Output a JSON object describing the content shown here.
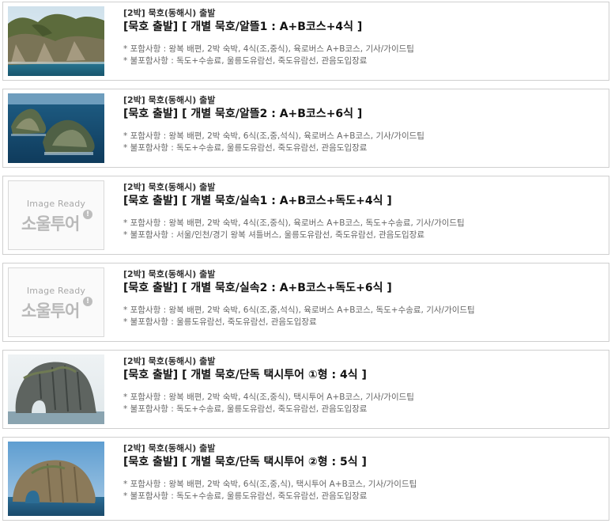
{
  "tours": [
    {
      "category": "[2박] 묵호(동해시) 출발",
      "title": "[묵호 출발] [ 개별 묵호/알뜰1 : A+B코스+4식 ]",
      "include": "* 포함사항 : 왕복 배편, 2박 숙박, 4식(조,중식), 육로버스 A+B코스, 기사/가이드팁",
      "exclude": "* 불포함사항 : 독도+수송료, 울릉도유람선, 죽도유람선, 관음도입장료",
      "image": "coastal-cliff-photo"
    },
    {
      "category": "[2박] 묵호(동해시) 출발",
      "title": "[묵호 출발] [ 개별 묵호/알뜰2 : A+B코스+6식 ]",
      "include": "* 포함사항 : 왕복 배편, 2박 숙박, 6식(조,중,석식), 육로버스 A+B코스, 기사/가이드팁",
      "exclude": "* 불포함사항 : 독도+수송료, 울릉도유람선, 죽도유람선, 관음도입장료",
      "image": "dokdo-islands-photo"
    },
    {
      "category": "[2박] 묵호(동해시) 출발",
      "title": "[묵호 출발] [ 개별 묵호/실속1 : A+B코스+독도+4식 ]",
      "include": "* 포함사항 : 왕복 배편, 2박 숙박, 4식(조,중식), 육로버스 A+B코스, 독도+수송료, 기사/가이드팁",
      "exclude": "* 불포함사항 : 서울/인천/경기 왕복 셔틀버스, 울릉도유람선, 죽도유람선, 관음도입장료",
      "image": "placeholder"
    },
    {
      "category": "[2박] 묵호(동해시) 출발",
      "title": "[묵호 출발] [ 개별 묵호/실속2 : A+B코스+독도+6식 ]",
      "include": "* 포함사항 : 왕복 배편, 2박 숙박, 6식(조,중,석식), 육로버스 A+B코스, 독도+수송료, 기사/가이드팁",
      "exclude": "* 불포함사항 : 울릉도유람선, 죽도유람선, 관음도입장료",
      "image": "placeholder"
    },
    {
      "category": "[2박] 묵호(동해시) 출발",
      "title": "[묵호 출발] [ 개별 묵호/단독 택시투어 ①형 : 4식 ]",
      "include": "* 포함사항 : 왕복 배편, 2박 숙박, 4식(조,중식), 택시투어 A+B코스, 기사/가이드팁",
      "exclude": "* 불포함사항 : 독도+수송료, 울릉도유람선, 죽도유람선, 관음도입장료",
      "image": "elephant-rock-photo"
    },
    {
      "category": "[2박] 묵호(동해시) 출발",
      "title": "[묵호 출발] [ 개별 묵호/단독 택시투어 ②형 : 5식 ]",
      "include": "* 포함사항 : 왕복 배편, 2박 숙박, 6식(조,중,식), 택시투어 A+B코스, 기사/가이드팁",
      "exclude": "* 불포함사항 : 독도+수송료, 울릉도유람선, 죽도유람선, 관음도입장료",
      "image": "elephant-rock-sea-photo"
    }
  ],
  "placeholder": {
    "ready_text": "Image Ready",
    "logo_text": "소울투어",
    "logo_badge": "!"
  }
}
